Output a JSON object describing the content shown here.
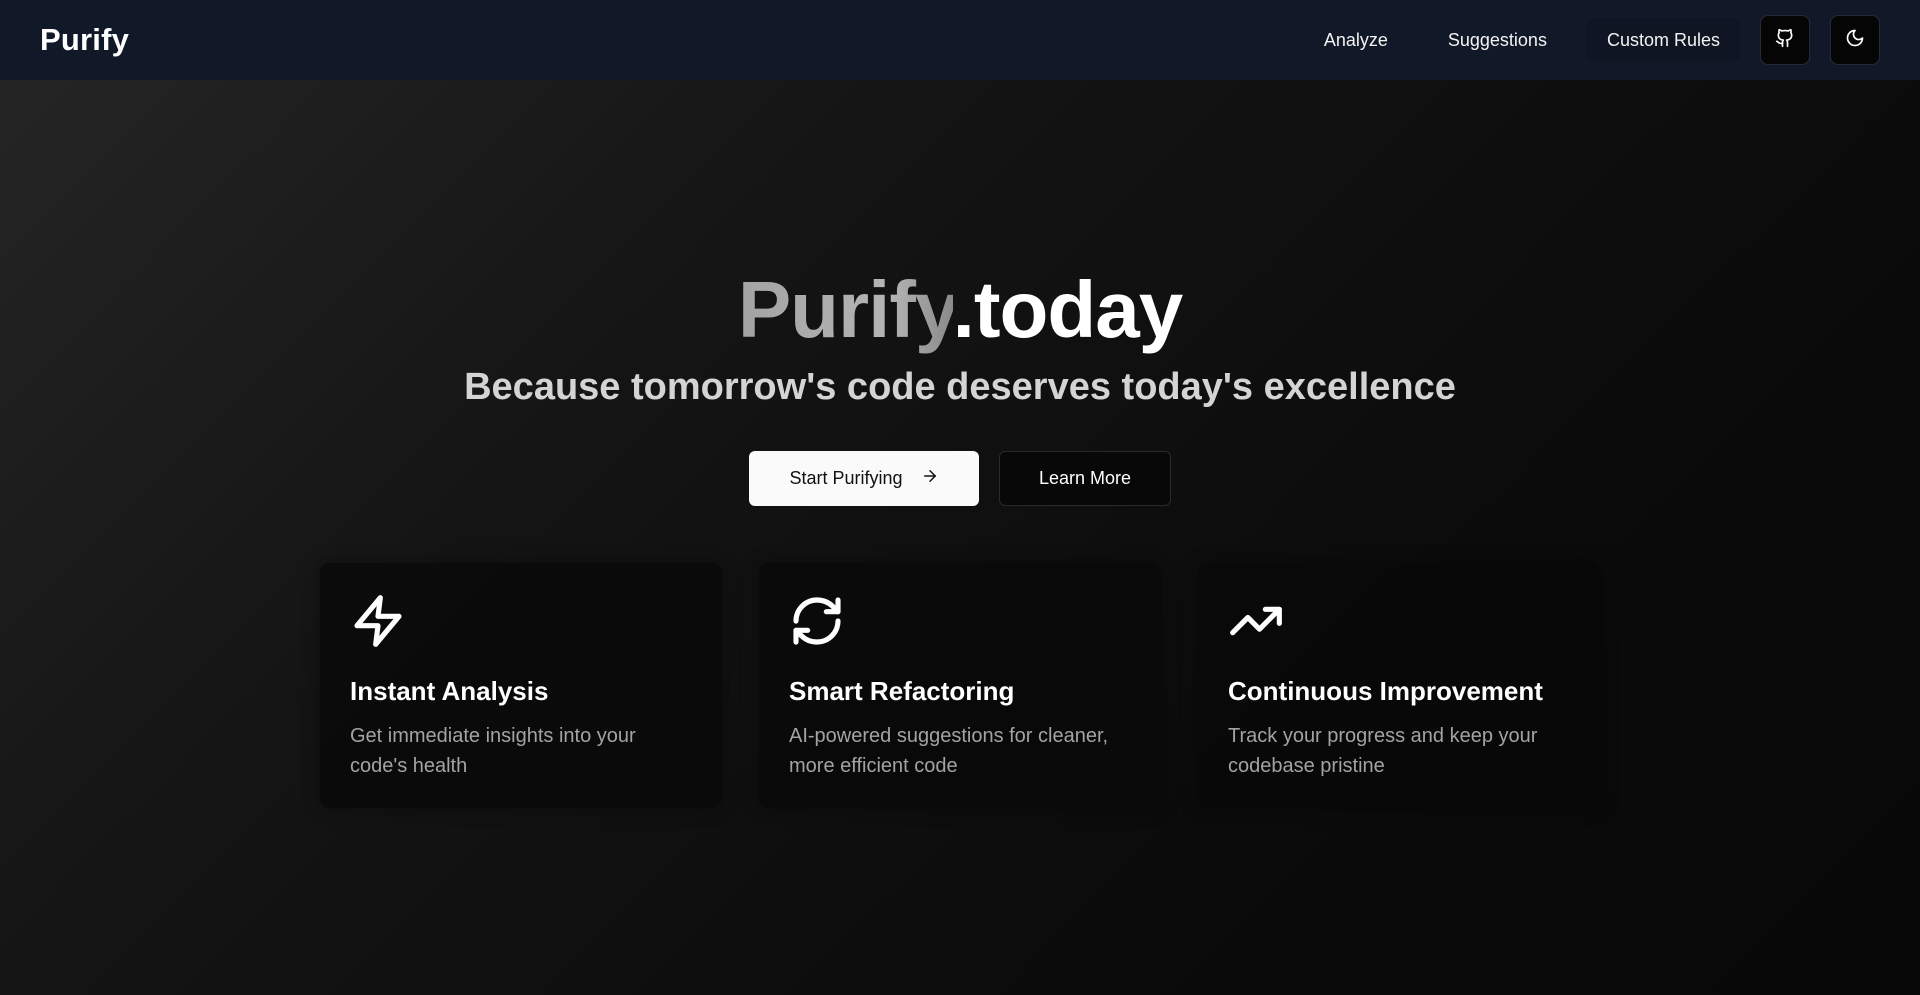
{
  "header": {
    "brand": "Purify",
    "nav": [
      {
        "label": "Analyze"
      },
      {
        "label": "Suggestions"
      },
      {
        "label": "Custom Rules"
      }
    ],
    "icons": {
      "github": "github-icon",
      "theme": "moon-icon"
    }
  },
  "hero": {
    "title_part_a": "Purify",
    "title_part_b": ".today",
    "subtitle": "Because tomorrow's code deserves today's excellence",
    "primary_cta": "Start Purifying",
    "secondary_cta": "Learn More"
  },
  "features": [
    {
      "icon": "lightning-icon",
      "title": "Instant Analysis",
      "description": "Get immediate insights into your code's health"
    },
    {
      "icon": "refresh-icon",
      "title": "Smart Refactoring",
      "description": "AI-powered suggestions for cleaner, more efficient code"
    },
    {
      "icon": "trending-up-icon",
      "title": "Continuous Improvement",
      "description": "Track your progress and keep your codebase pristine"
    }
  ]
}
